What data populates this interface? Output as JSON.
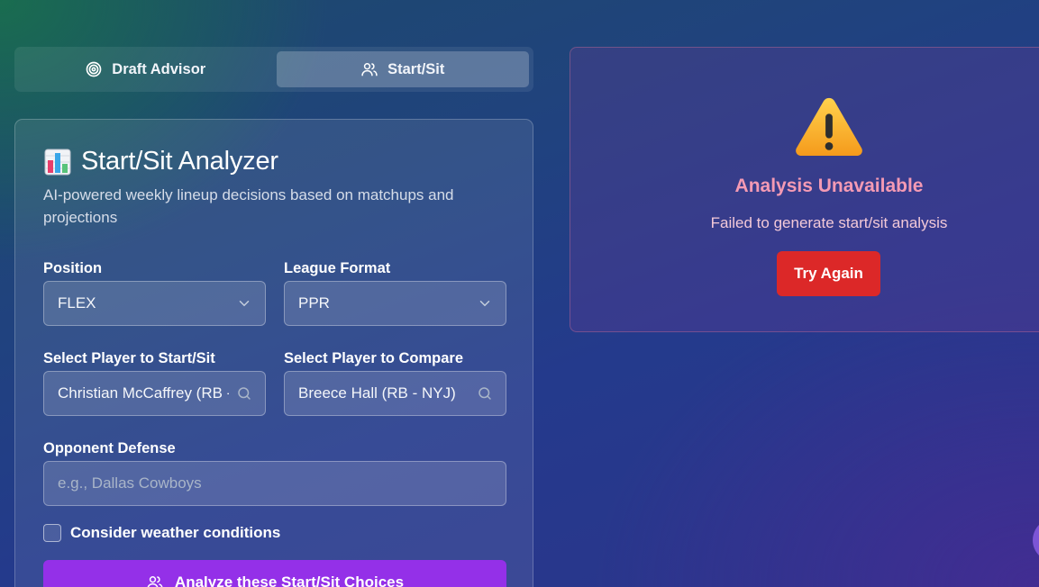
{
  "tabs": [
    {
      "label": "Draft Advisor",
      "icon": "target-icon",
      "active": false
    },
    {
      "label": "Start/Sit",
      "icon": "users-icon",
      "active": true
    }
  ],
  "analyzer": {
    "title": "Start/Sit Analyzer",
    "title_icon": "bar-chart-icon",
    "subtitle": "AI-powered weekly lineup decisions based on matchups and projections",
    "position": {
      "label": "Position",
      "value": "FLEX"
    },
    "league_format": {
      "label": "League Format",
      "value": "PPR"
    },
    "player_start_sit": {
      "label": "Select Player to Start/Sit",
      "value": "Christian McCaffrey (RB - SF)"
    },
    "player_compare": {
      "label": "Select Player to Compare",
      "value": "Breece Hall (RB - NYJ)"
    },
    "opponent_defense": {
      "label": "Opponent Defense",
      "value": "",
      "placeholder": "e.g., Dallas Cowboys"
    },
    "weather": {
      "label": "Consider weather conditions",
      "checked": false
    },
    "analyze_button": "Analyze these Start/Sit Choices"
  },
  "error": {
    "icon": "warning-icon",
    "title": "Analysis Unavailable",
    "message": "Failed to generate start/sit analysis",
    "retry_button": "Try Again"
  },
  "colors": {
    "accent_purple": "#9430e8",
    "danger_red": "#dc2828",
    "error_pink": "#f49ab4"
  }
}
